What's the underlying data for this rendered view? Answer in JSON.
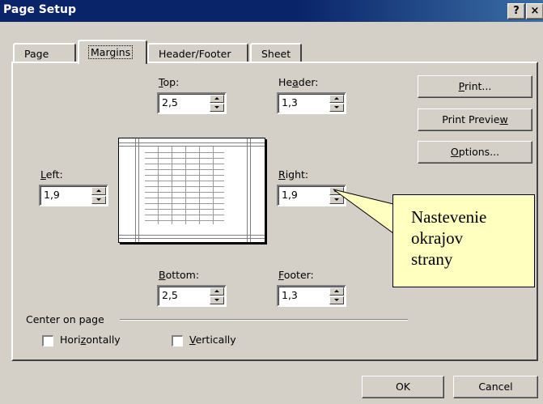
{
  "dialog": {
    "title": "Page Setup",
    "help_glyph": "?",
    "close_glyph": "×"
  },
  "tabs": [
    {
      "label": "Page",
      "active": false
    },
    {
      "label": "Margins",
      "active": true
    },
    {
      "label": "Header/Footer",
      "active": false
    },
    {
      "label": "Sheet",
      "active": false
    }
  ],
  "margins": {
    "top": {
      "label": "Top:",
      "access": "T",
      "rest": "op:",
      "value": "2,5"
    },
    "header": {
      "label": "Header:",
      "pre": "He",
      "access": "a",
      "rest": "der:",
      "value": "1,3"
    },
    "left": {
      "label": "Left:",
      "access": "L",
      "rest": "eft:",
      "value": "1,9"
    },
    "right": {
      "label": "Right:",
      "access": "R",
      "rest": "ight:",
      "value": "1,9"
    },
    "bottom": {
      "label": "Bottom:",
      "access": "B",
      "rest": "ottom:",
      "value": "2,5"
    },
    "footer": {
      "label": "Footer:",
      "access": "F",
      "rest": "ooter:",
      "value": "1,3"
    }
  },
  "buttons": {
    "print": {
      "label": "Print...",
      "access": "P",
      "rest": "rint..."
    },
    "preview": {
      "label": "Print Preview",
      "pre": "Print Previe",
      "access": "w"
    },
    "options": {
      "label": "Options...",
      "access": "O",
      "rest": "ptions..."
    },
    "ok": "OK",
    "cancel": "Cancel"
  },
  "center_on_page": {
    "legend": "Center on page",
    "horizontally": {
      "label": "Horizontally",
      "pre": "Hori",
      "access": "z",
      "rest": "ontally",
      "checked": false
    },
    "vertically": {
      "label": "Vertically",
      "access": "V",
      "rest": "ertically",
      "checked": false
    }
  },
  "callout": {
    "line1": "Nastevenie",
    "line2": "okrajov",
    "line3": "strany",
    "fill": "#ffffc0"
  },
  "colors": {
    "titlebar": "#0a246a",
    "face": "#d4d0c8"
  }
}
